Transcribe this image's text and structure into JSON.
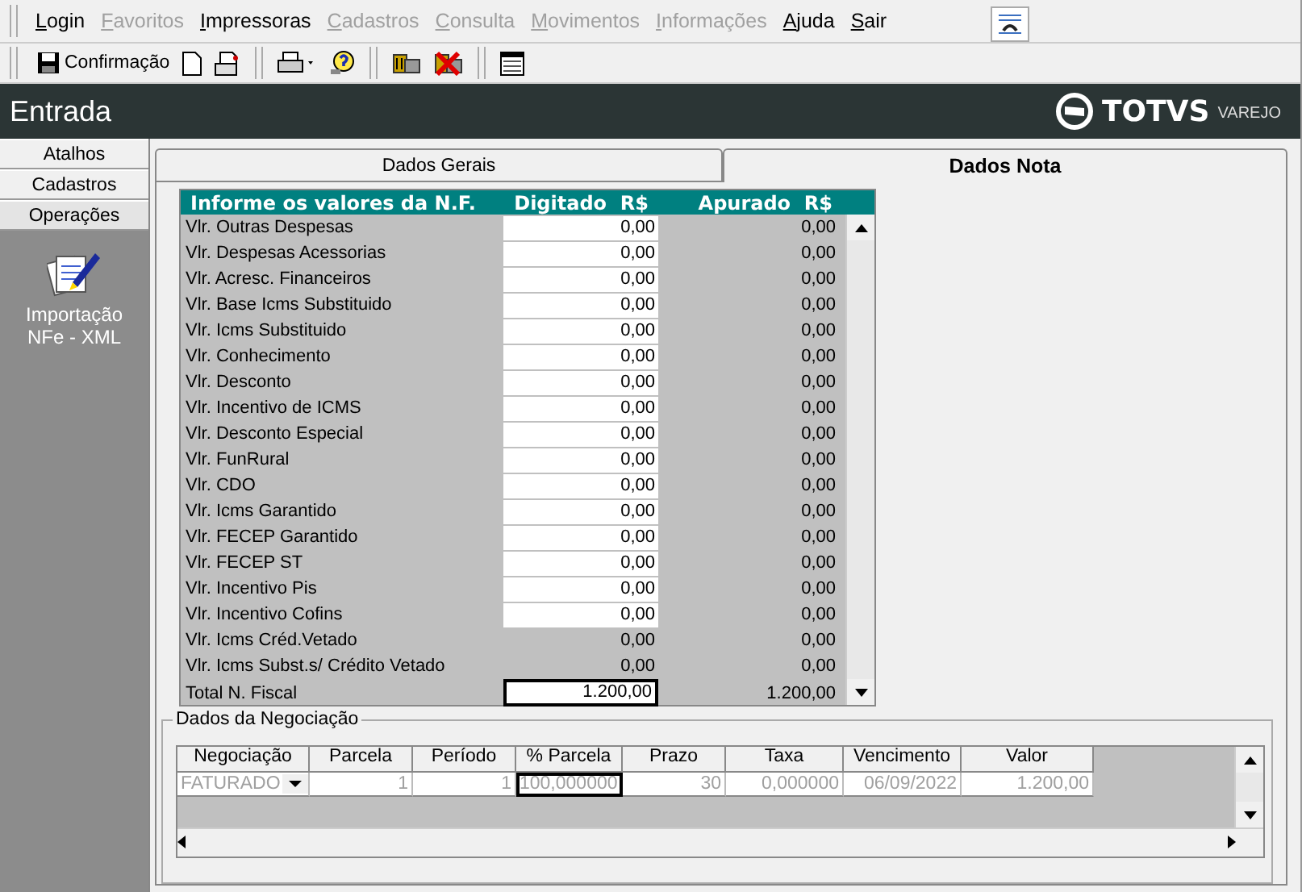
{
  "menu": [
    {
      "label": "Login",
      "disabled": false
    },
    {
      "label": "Favoritos",
      "disabled": true
    },
    {
      "label": "Impressoras",
      "disabled": false
    },
    {
      "label": "Cadastros",
      "disabled": true
    },
    {
      "label": "Consulta",
      "disabled": true
    },
    {
      "label": "Movimentos",
      "disabled": true
    },
    {
      "label": "Informações",
      "disabled": true
    },
    {
      "label": "Ajuda",
      "disabled": false
    },
    {
      "label": "Sair",
      "disabled": false
    }
  ],
  "toolbar": {
    "confirm_label": "Confirmação"
  },
  "header": {
    "title": "Entrada",
    "brand": "TOTVS",
    "brand_sub": "VAREJO"
  },
  "sidebar": {
    "items": [
      {
        "label": "Atalhos",
        "selected": false
      },
      {
        "label": "Cadastros",
        "selected": false
      },
      {
        "label": "Operações",
        "selected": true
      }
    ],
    "shortcut": "Importação NFe - XML"
  },
  "tabs": [
    {
      "label": "Dados Gerais",
      "selected": false
    },
    {
      "label": "Dados Nota",
      "selected": true
    }
  ],
  "values_table": {
    "title": "Informe os valores da N.F.",
    "columns": [
      "Digitado  R$",
      "Apurado  R$"
    ],
    "rows": [
      {
        "label": "Vlr. Outras Despesas",
        "kind": "input",
        "typed": "0,00",
        "computed": "0,00"
      },
      {
        "label": "Vlr. Despesas Acessorias",
        "kind": "input",
        "typed": "0,00",
        "computed": "0,00"
      },
      {
        "label": "Vlr. Acresc. Financeiros",
        "kind": "input",
        "typed": "0,00",
        "computed": "0,00"
      },
      {
        "label": "Vlr. Base Icms Substituido",
        "kind": "input",
        "typed": "0,00",
        "computed": "0,00"
      },
      {
        "label": "Vlr. Icms Substituido",
        "kind": "input",
        "typed": "0,00",
        "computed": "0,00"
      },
      {
        "label": "Vlr. Conhecimento",
        "kind": "input",
        "typed": "0,00",
        "computed": "0,00"
      },
      {
        "label": "Vlr. Desconto",
        "kind": "input",
        "typed": "0,00",
        "computed": "0,00"
      },
      {
        "label": "Vlr. Incentivo de ICMS",
        "kind": "input",
        "typed": "0,00",
        "computed": "0,00"
      },
      {
        "label": "Vlr. Desconto Especial",
        "kind": "input",
        "typed": "0,00",
        "computed": "0,00"
      },
      {
        "label": "Vlr. FunRural",
        "kind": "input",
        "typed": "0,00",
        "computed": "0,00"
      },
      {
        "label": "Vlr. CDO",
        "kind": "input",
        "typed": "0,00",
        "computed": "0,00"
      },
      {
        "label": "Vlr. Icms Garantido",
        "kind": "input",
        "typed": "0,00",
        "computed": "0,00"
      },
      {
        "label": "Vlr. FECEP Garantido",
        "kind": "input",
        "typed": "0,00",
        "computed": "0,00"
      },
      {
        "label": "Vlr. FECEP ST",
        "kind": "input",
        "typed": "0,00",
        "computed": "0,00"
      },
      {
        "label": "Vlr. Incentivo Pis",
        "kind": "input",
        "typed": "0,00",
        "computed": "0,00"
      },
      {
        "label": "Vlr. Incentivo Cofins",
        "kind": "input",
        "typed": "0,00",
        "computed": "0,00"
      },
      {
        "label": "Vlr. Icms Créd.Vetado",
        "kind": "readonly",
        "typed": "0,00",
        "computed": "0,00"
      },
      {
        "label": "Vlr. Icms Subst.s/ Crédito Vetado",
        "kind": "readonly",
        "typed": "0,00",
        "computed": "0,00"
      },
      {
        "label": "Total N. Fiscal",
        "kind": "total",
        "typed": "1.200,00",
        "computed": "1.200,00"
      }
    ]
  },
  "negotiation": {
    "title": "Dados da Negociação",
    "columns": [
      "Negociação",
      "Parcela",
      "Período",
      "% Parcela",
      "Prazo",
      "Taxa",
      "Vencimento",
      "Valor"
    ],
    "rows": [
      [
        "FATURADO",
        "1",
        "1",
        "100,000000",
        "30",
        "0,000000",
        "06/09/2022",
        "1.200,00"
      ]
    ]
  }
}
